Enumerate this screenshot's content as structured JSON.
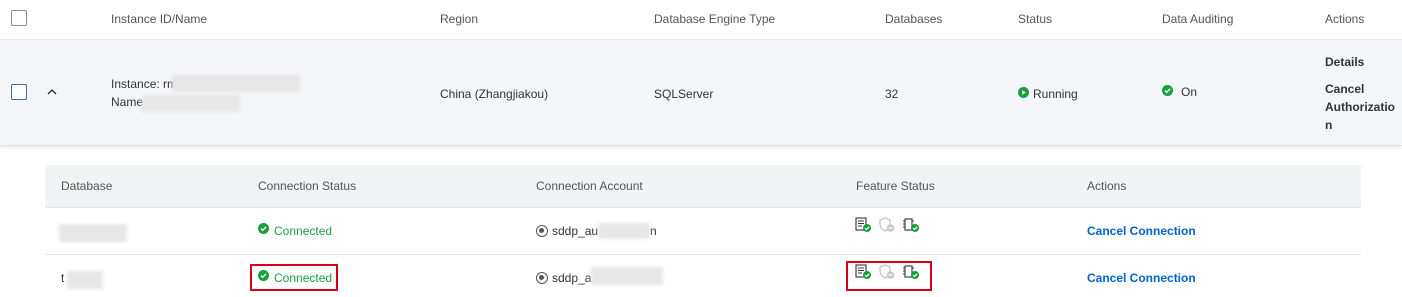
{
  "table": {
    "headers": {
      "instance": "Instance ID/Name",
      "region": "Region",
      "engine": "Database Engine Type",
      "databases": "Databases",
      "status": "Status",
      "auditing": "Data Auditing",
      "actions": "Actions"
    },
    "instance_row": {
      "instance_prefix": "Instance: rm",
      "name_prefix": "Name",
      "region": "China (Zhangjiakou)",
      "engine": "SQLServer",
      "databases": "32",
      "status": "Running",
      "auditing": "On",
      "action_details": "Details",
      "action_cancel_line1": "Cancel",
      "action_cancel_line2": "Authorizatio",
      "action_cancel_line3": "n"
    }
  },
  "subtable": {
    "headers": {
      "database": "Database",
      "connection_status": "Connection Status",
      "connection_account": "Connection Account",
      "feature_status": "Feature Status",
      "actions": "Actions"
    },
    "rows": [
      {
        "database": "",
        "status": "Connected",
        "account_prefix": "sddp_au",
        "account_suffix": "n",
        "action": "Cancel Connection"
      },
      {
        "database": "t",
        "status": "Connected",
        "account_prefix": "sddp_a",
        "account_suffix": "",
        "action": "Cancel Connection"
      }
    ]
  },
  "icons": {
    "status_running": "play-circle-icon",
    "auditing_on": "check-circle-icon",
    "connected": "check-circle-icon",
    "feature_1": "document-check-icon",
    "feature_2": "shield-minus-icon",
    "feature_3": "chip-check-icon",
    "account": "eye-icon",
    "expand": "chevron-up-icon"
  },
  "colors": {
    "link": "#0064c8",
    "success": "#1a9e3e",
    "highlight": "#d9001b"
  }
}
